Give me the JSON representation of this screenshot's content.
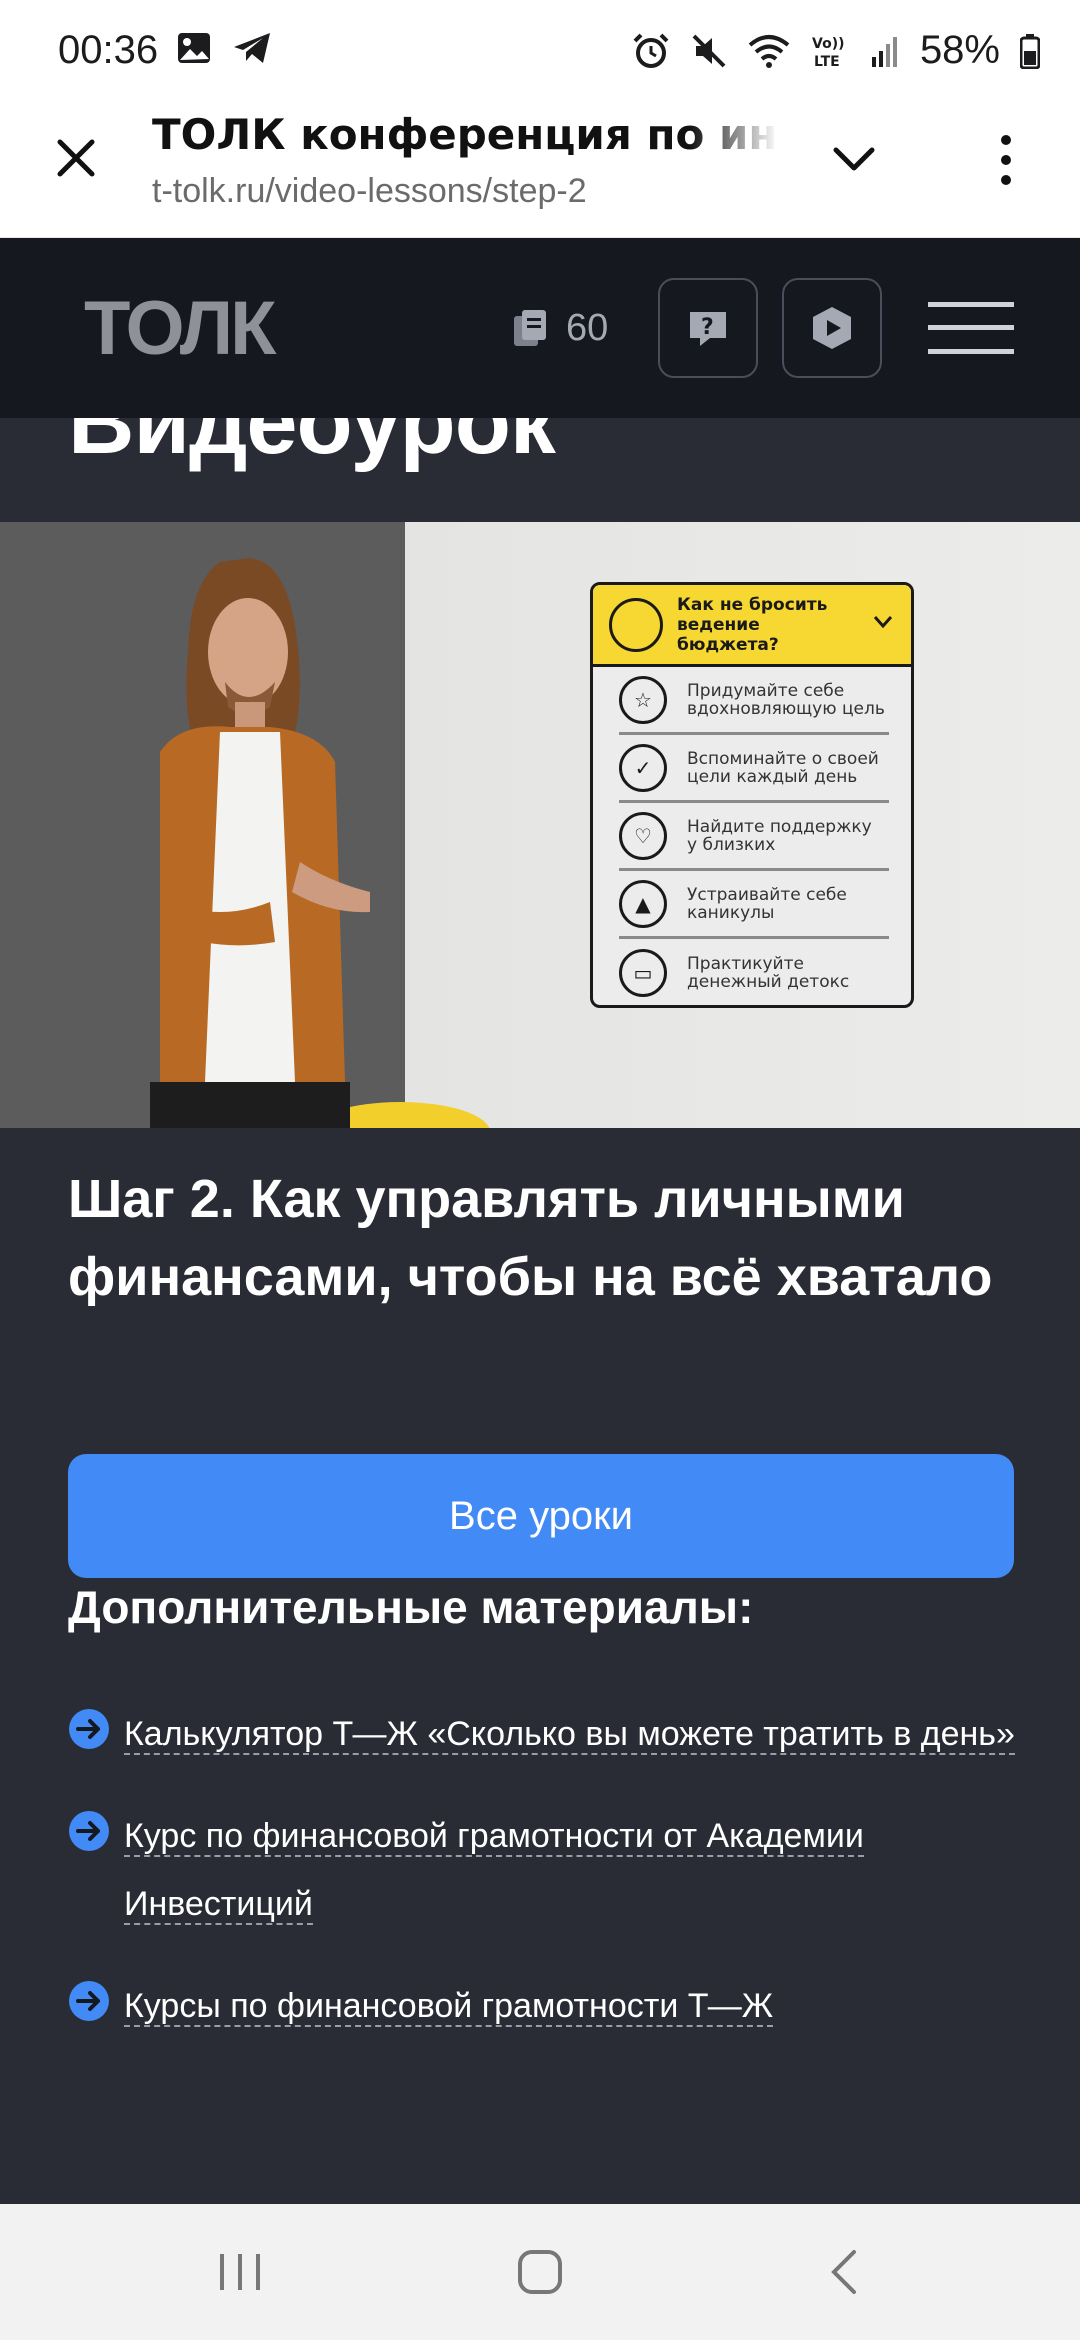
{
  "status_bar": {
    "time": "00:36",
    "battery": "58%",
    "icons": [
      "image-icon",
      "telegram-icon",
      "alarm-icon",
      "mute-icon",
      "wifi-icon",
      "volte-icon",
      "signal-icon",
      "battery-icon"
    ]
  },
  "browser": {
    "page_title": "ТОЛК конференция по инвест",
    "url": "t-tolk.ru/video-lessons/step-2"
  },
  "site_header": {
    "logo_text": "ТОЛК",
    "cards_count": "60"
  },
  "page": {
    "section_heading": "Видеоурок",
    "lesson_title": "Шаг 2. Как управлять личными финансами, чтобы на всё хватало",
    "all_lessons_button": "Все уроки",
    "extra_materials_title": "Дополнительные материалы:"
  },
  "video_card": {
    "header": "Как не бросить ведение бюджета?",
    "items": [
      "Придумайте себе\nвдохновляющую цель",
      "Вспоминайте о своей\nцели каждый день",
      "Найдите поддержку\nу близких",
      "Устраивайте себе\nканикулы",
      "Практикуйте\nденежный детокс"
    ]
  },
  "links": [
    {
      "label": "Калькулятор Т—Ж «Сколько вы можете тратить в день»"
    },
    {
      "label": "Курс по финансовой грамотности от Академии Инвестиций"
    },
    {
      "label": "Курсы по финансовой грамотности Т—Ж"
    }
  ],
  "colors": {
    "page_bg": "#2a2c35",
    "header_bg": "#16181f",
    "accent_blue": "#428af5",
    "card_yellow": "#f7d731"
  }
}
